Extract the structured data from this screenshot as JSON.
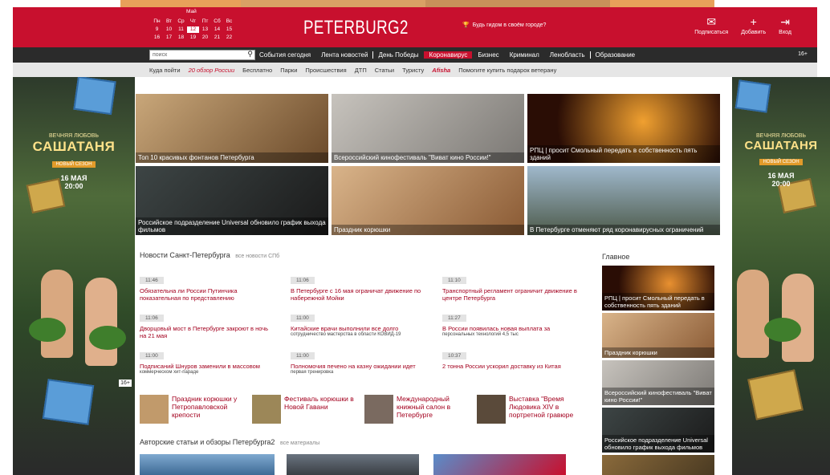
{
  "header": {
    "logo": "PETERBURG2",
    "calendar": {
      "month": "Май",
      "weekdays": [
        "Пн",
        "Вт",
        "Ср",
        "Чт",
        "Пт",
        "Сб",
        "Вс"
      ],
      "rows": [
        [
          "9",
          "10",
          "11",
          "12",
          "13",
          "14",
          "15"
        ],
        [
          "16",
          "17",
          "18",
          "19",
          "20",
          "21",
          "22"
        ]
      ],
      "today": "12"
    },
    "quiz": "Будь гидом в своём городе?",
    "icons": [
      {
        "name": "mail",
        "label": "Подписаться",
        "glyph": "✉"
      },
      {
        "name": "add",
        "label": "Добавить",
        "glyph": "+"
      },
      {
        "name": "login",
        "label": "Вход",
        "glyph": "⇥"
      }
    ]
  },
  "nav": {
    "search_placeholder": "поиск",
    "items": [
      "События сегодня",
      "Лента новостей",
      "День Победы",
      "Коронавирус",
      "Бизнес",
      "Криминал",
      "Ленобласть",
      "Образование"
    ],
    "active": "День Победы",
    "age": "16+"
  },
  "subnav": {
    "items": [
      "Куда пойти",
      "20 обзор России",
      "Бесплатно",
      "Парки",
      "Происшествия",
      "ДТП",
      "Статьи",
      "Туристу",
      "Afisha",
      "Помогите купить подарок ветерану"
    ]
  },
  "banner": {
    "line1": "ВЕЧНЯЯ ЛЮБОВЬ",
    "title": "САШАТАНЯ",
    "badge": "НОВЫЙ СЕЗОН",
    "date": "16 МАЯ",
    "time": "20:00",
    "age": "16+"
  },
  "tiles": [
    {
      "caption": "Топ 10 красивых фонтанов Петербурга",
      "color": "#8a6a3b"
    },
    {
      "caption": "Всероссийский кинофестиваль \"Виват кино России!\"",
      "color": "#a8a4a0"
    },
    {
      "caption": "РПЦ | просит Смольный передать в собственность пять зданий",
      "color": "#3a1a10"
    },
    {
      "caption": "Российское подразделение Universal обновило график выхода фильмов",
      "color": "#2a2a2a"
    },
    {
      "caption": "Праздник корюшки",
      "color": "#b68d66"
    },
    {
      "caption": "В Петербурге отменяют ряд коронавирусных ограничений",
      "color": "#6c7a84"
    }
  ],
  "section": {
    "title": "Новости Санкт-Петербурга",
    "sub": "все новости СПб"
  },
  "news": [
    {
      "time": "11:46",
      "head": "Обязательна ли России Путинчика показательная по представлению",
      "lead": ""
    },
    {
      "time": "11:06",
      "head": "В Петербурге с 16 мая ограничат движение по набережной Мойки",
      "lead": ""
    },
    {
      "time": "11:10",
      "head": "Транспортный регламент ограничит движение в центре Петербурга",
      "lead": ""
    },
    {
      "time": "11:06",
      "head": "Дворцовый мост в Петербурге закроют в ночь на 21 мая",
      "lead": ""
    },
    {
      "time": "11:00",
      "head": "Китайские врачи выполнили все долго",
      "lead": "сотрудничество мастерства в области КОВИД-19"
    },
    {
      "time": "11:27",
      "head": "В России появилась новая выплата за",
      "lead": "персональных технологий 4,5 тыс"
    },
    {
      "time": "11:00",
      "head": "Подписаний Шнуров заменили в массовом",
      "lead": "коммерческом хит-параде"
    },
    {
      "time": "11:00",
      "head": "Полномочия печено на казну ожидании идет",
      "lead": "первая тренировка"
    },
    {
      "time": "10:37",
      "head": "2 тоннa России ускорил доставку из Китая",
      "lead": ""
    }
  ],
  "features": [
    {
      "text": "Праздник корюшки у Петропавловской крепости",
      "color": "#c19a6b"
    },
    {
      "text": "Фестиваль корюшки в Новой Гавани",
      "color": "#9c8758"
    },
    {
      "text": "Международный книжный салон в Петербурге",
      "color": "#7a6a60"
    },
    {
      "text": "Выставка \"Время Людовика XIV в портретной гравюре",
      "color": "#5a4a3a"
    }
  ],
  "authors": {
    "title": "Авторские статьи и обзоры Петербурга2",
    "sub": "все материалы"
  },
  "aside": {
    "title": "Главное",
    "tiles": [
      {
        "caption": "РПЦ | просит Смольный передать в собственность пять зданий",
        "color": "#3a1a10"
      },
      {
        "caption": "Праздник корюшки",
        "color": "#b68d66"
      },
      {
        "caption": "Всероссийский кинофестиваль \"Виват кино России!\"",
        "color": "#a8a4a0"
      },
      {
        "caption": "Российское подразделение Universal обновило график выхода фильмов",
        "color": "#2a2a2a"
      }
    ]
  }
}
